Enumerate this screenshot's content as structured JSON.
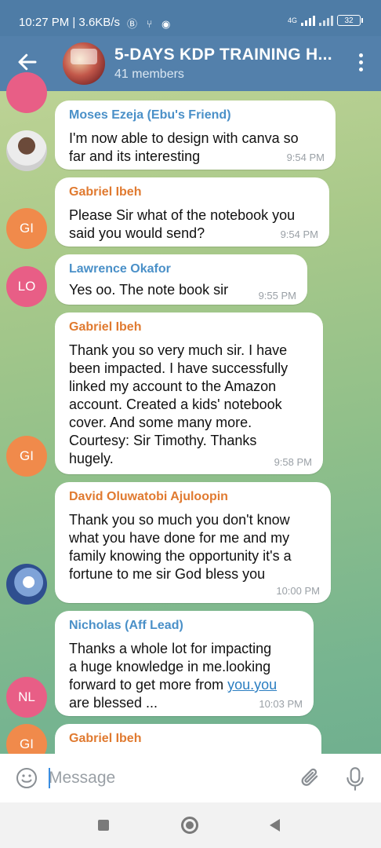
{
  "status_bar": {
    "time": "10:27 PM | 3.6KB/s",
    "icons": "Ⓑ ⑂ ◉",
    "network": "4G",
    "battery": "32"
  },
  "header": {
    "title": "5-DAYS KDP TRAINING H...",
    "members": "41 members"
  },
  "messages": [
    {
      "sender": "Moses Ezeja (Ebu's Friend)",
      "sender_color": "#4a90c8",
      "text": "I'm now able to design with canva so\nfar and its interesting",
      "time": "9:54 PM",
      "avatar": "photo"
    },
    {
      "sender": "Gabriel Ibeh",
      "sender_color": "#e07a30",
      "text": "Please Sir what of the notebook you\nsaid you would send?",
      "time": "9:54 PM",
      "avatar_initials": "GI"
    },
    {
      "sender": "Lawrence Okafor",
      "sender_color": "#4a90c8",
      "text": "Yes oo.  The note book sir",
      "time": "9:55 PM",
      "avatar_initials": "LO"
    },
    {
      "sender": "Gabriel Ibeh",
      "sender_color": "#e07a30",
      "text": "Thank you so very much sir. I  have\nbeen impacted. I have successfully\nlinked my account to the Amazon\naccount. Created a kids' notebook\ncover. And some many more.\nCourtesy: Sir Timothy. Thanks\nhugely.",
      "time": "9:58 PM",
      "avatar_initials": "GI"
    },
    {
      "sender": "David Oluwatobi Ajuloopin",
      "sender_color": "#e07a30",
      "text": "Thank you so much you don't know\nwhat you have done for me and my\nfamily knowing the opportunity it's a\nfortune to me sir God bless you",
      "time": "10:00 PM",
      "avatar": "photo"
    },
    {
      "sender": "Nicholas (Aff Lead)",
      "sender_color": "#4a90c8",
      "text_before_link": "Thanks a whole lot for impacting\na huge knowledge in me.looking\nforward to get more from ",
      "link_text": "you.you",
      "text_after_link": "\nare blessed ...",
      "time": "10:03 PM",
      "avatar_initials": "NL"
    },
    {
      "sender": "Gabriel Ibeh",
      "sender_color": "#e07a30",
      "avatar_initials": "GI"
    }
  ],
  "input": {
    "placeholder": "Message"
  },
  "colors": {
    "header_bg": "#5380ab",
    "avatar_orange": "#f08a4b",
    "avatar_pink": "#e85e86",
    "link": "#2b7ec1"
  }
}
